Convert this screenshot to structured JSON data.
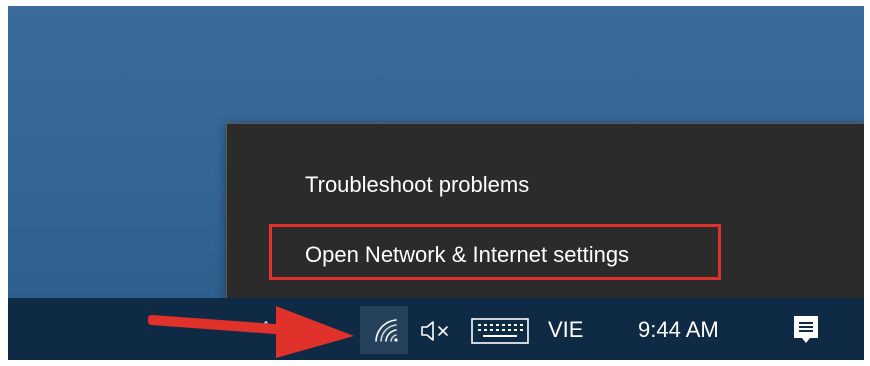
{
  "context_menu": {
    "items": [
      {
        "label": "Troubleshoot problems"
      },
      {
        "label": "Open Network & Internet settings"
      }
    ],
    "highlighted_index": 1
  },
  "taskbar": {
    "tray_overflow_glyph": "^",
    "language": "VIE",
    "time": "9:44 AM",
    "icons": [
      "wifi-icon",
      "volume-muted-icon",
      "touch-keyboard-icon",
      "action-center-icon"
    ]
  },
  "colors": {
    "desktop": "#346595",
    "taskbar": "#0e2a45",
    "menu_background": "#2b2b2b",
    "highlight": "#e0312b",
    "arrow": "#e0312b"
  }
}
